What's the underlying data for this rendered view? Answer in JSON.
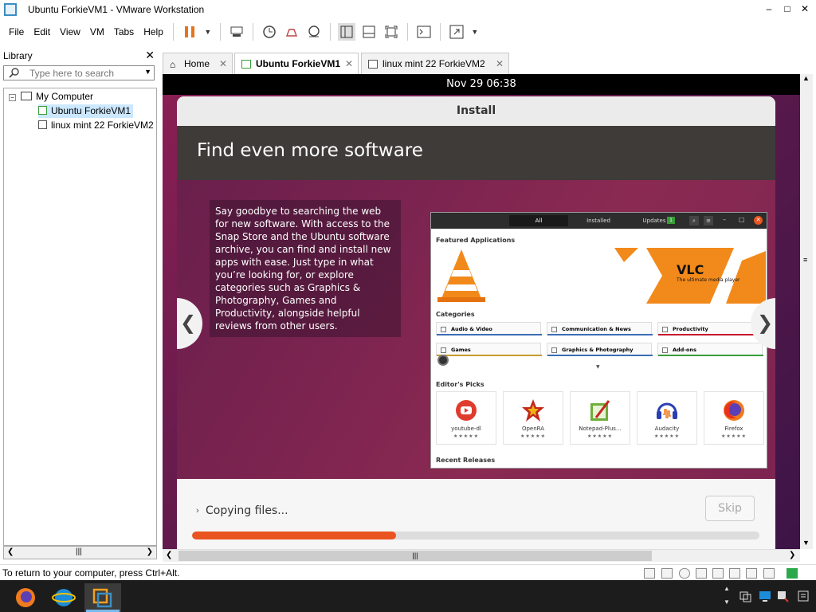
{
  "window": {
    "title": "Ubuntu ForkieVM1 - VMware Workstation",
    "minimize": "–",
    "maximize": "□",
    "close": "✕"
  },
  "menu": {
    "file": "File",
    "edit": "Edit",
    "view": "View",
    "vm": "VM",
    "tabs": "Tabs",
    "help": "Help"
  },
  "library": {
    "title": "Library",
    "close": "✕",
    "search_placeholder": "Type here to search",
    "tree": {
      "root": "My Computer",
      "items": [
        {
          "label": "Ubuntu ForkieVM1"
        },
        {
          "label": "linux mint 22 ForkieVM2"
        }
      ]
    }
  },
  "tabs": [
    {
      "label": "Home",
      "close": "✕"
    },
    {
      "label": "Ubuntu ForkieVM1",
      "close": "✕"
    },
    {
      "label": "linux mint 22 ForkieVM2",
      "close": "✕"
    }
  ],
  "guest": {
    "clock": "Nov 29  06:38",
    "installer": {
      "title": "Install",
      "heading": "Find even more software",
      "description": "Say goodbye to searching the web for new software. With access to the Snap Store and the Ubuntu software archive, you can find and install new apps with ease. Just type in what you’re looking for, or explore categories such as Graphics & Photography, Games and Productivity, alongside helpful reviews from other users.",
      "nav_prev": "❮",
      "nav_next": "❯",
      "status": "Copying files...",
      "skip": "Skip",
      "progress": 0.36
    },
    "store": {
      "tabs": {
        "all": "All",
        "installed": "Installed",
        "updates": "Updates",
        "updates_count": "1"
      },
      "featured_title": "Featured Applications",
      "featured_app": "VLC",
      "featured_tagline": "The ultimate media player",
      "categories_title": "Categories",
      "categories": [
        {
          "label": "Audio & Video",
          "color": "#3c6db4"
        },
        {
          "label": "Communication & News",
          "color": "#3c6db4"
        },
        {
          "label": "Productivity",
          "color": "#c7162b"
        },
        {
          "label": "Games",
          "color": "#c89b2b"
        },
        {
          "label": "Graphics & Photography",
          "color": "#3c6db4"
        },
        {
          "label": "Add-ons",
          "color": "#3a9c3a"
        }
      ],
      "picks_title": "Editor's Picks",
      "picks": [
        {
          "name": "youtube-dl",
          "rating": "★★★★★",
          "color": "#e03c2d"
        },
        {
          "name": "OpenRA",
          "rating": "★★★★★",
          "color": "#c2281c"
        },
        {
          "name": "Notepad-Plus...",
          "rating": "★★★★★",
          "color": "#6fae3a"
        },
        {
          "name": "Audacity",
          "rating": "★★★★★",
          "color": "#2b3fb4"
        },
        {
          "name": "Firefox",
          "rating": "★★★★★",
          "color": "#f07b1d"
        }
      ],
      "recent_title": "Recent Releases"
    }
  },
  "statusbar": {
    "message": "To return to your computer, press Ctrl+Alt."
  },
  "colors": {
    "ubuntu_orange": "#e95420",
    "accent_blue": "#3b8ec2"
  }
}
